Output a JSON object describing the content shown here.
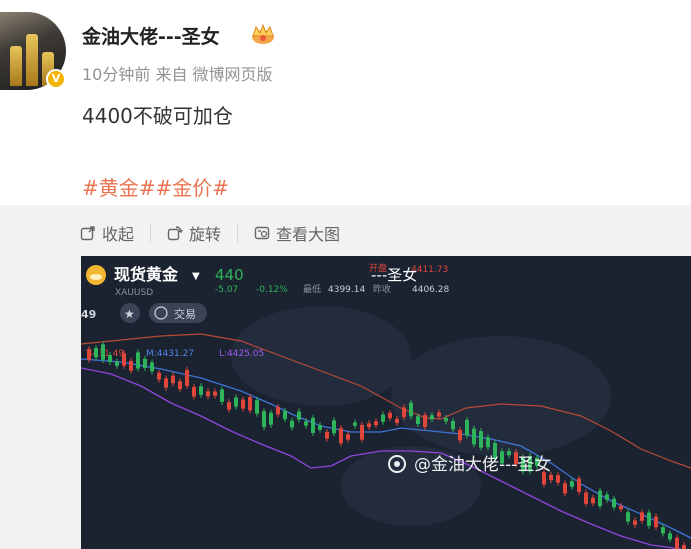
{
  "post": {
    "author": "金油大佬---圣女",
    "time": "10分钟前",
    "source": "来自 微博网页版",
    "text": "4400不破可加仓",
    "tags": [
      "#黄金#",
      "#金价#"
    ]
  },
  "toolbar": {
    "collapse_label": "收起",
    "rotate_label": "旋转",
    "view_large_label": "查看大图"
  },
  "chart_header": {
    "name": "现货黄金",
    "code": "XAUUSD",
    "price": "440",
    "change": "-5.07",
    "change_pct": "-0.12%",
    "low_label": "最低",
    "low": "4399.14",
    "prev_close_label": "昨收",
    "prev_close": "4406.28",
    "open_label": "开盘",
    "open": "4411.73",
    "tab_label": "交易",
    "ma_line": "M:4431.27",
    "l_line": "L:4425.05",
    "partial_label": "49",
    "overlay_name": "---圣女",
    "watermark": "@金油大佬---圣女"
  },
  "colors": {
    "up": "#2eb45a",
    "down": "#e0463a",
    "tag": "#eb7350",
    "chart_bg": "#1b2331"
  }
}
